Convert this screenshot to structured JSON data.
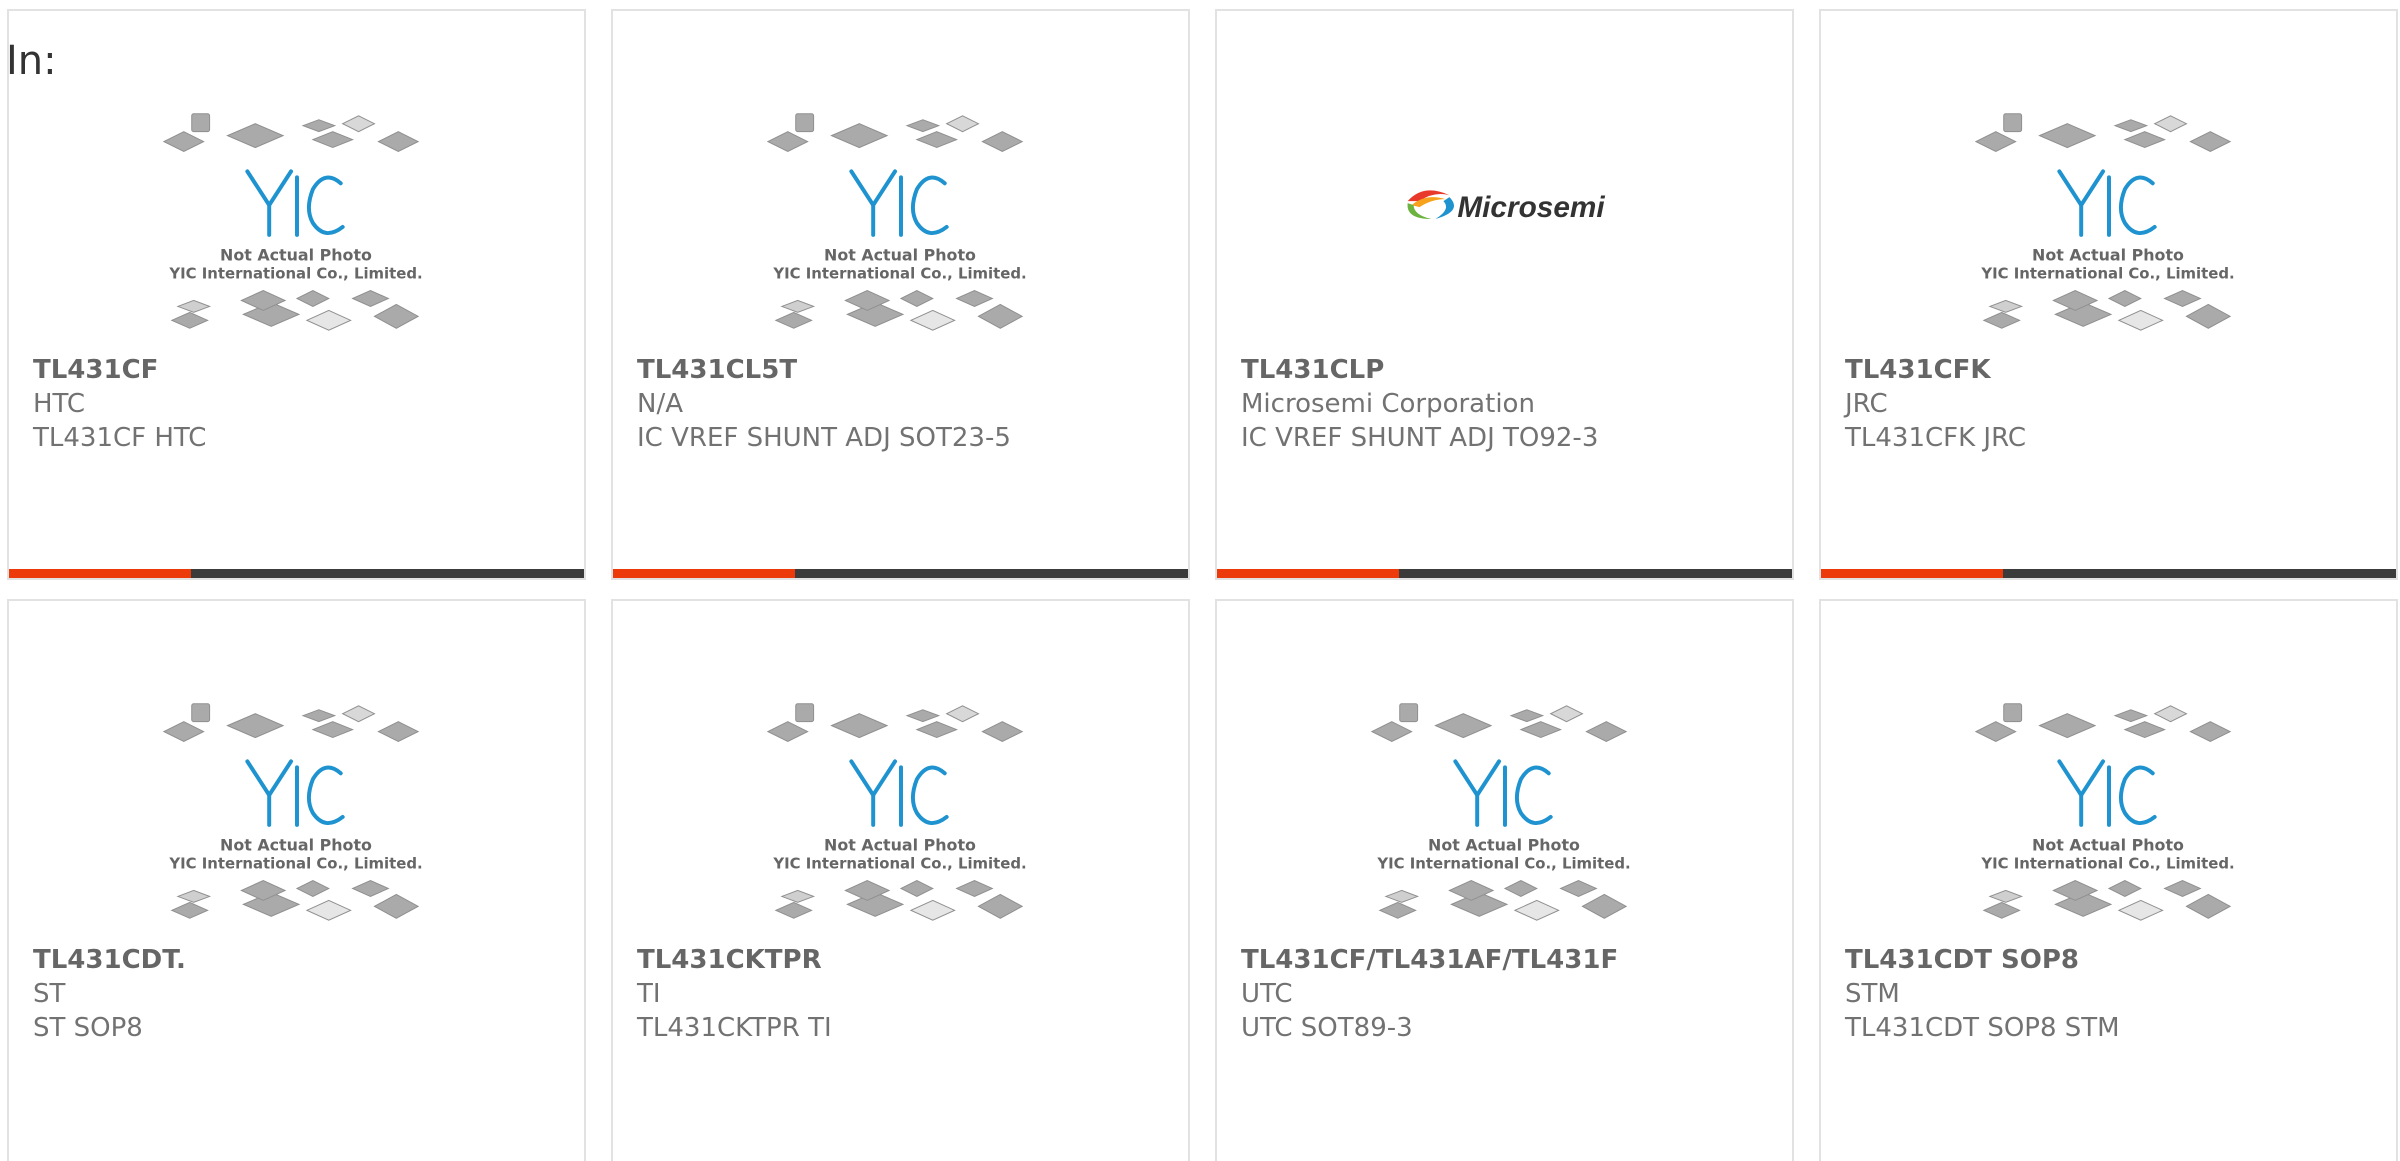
{
  "filter": {
    "label": "In:"
  },
  "placeholder_image": {
    "line1": "Not Actual Photo",
    "line2": "YIC International Co., Limited.",
    "logo_text": "YIC"
  },
  "microsemi_logo_text": "Microsemi",
  "colors": {
    "accent": "#ec3a0b",
    "bar": "#3b3b3b",
    "yic_blue": "#1f93cf",
    "text": "#666666"
  },
  "products": [
    {
      "part": "TL431CF",
      "brand": "HTC",
      "desc": "TL431CF HTC",
      "image": "yic-placeholder"
    },
    {
      "part": "TL431CL5T",
      "brand": "N/A",
      "desc": "IC VREF SHUNT ADJ SOT23-5",
      "image": "yic-placeholder"
    },
    {
      "part": "TL431CLP",
      "brand": "Microsemi Corporation",
      "desc": "IC VREF SHUNT ADJ TO92-3",
      "image": "microsemi-logo"
    },
    {
      "part": "TL431CFK",
      "brand": "JRC",
      "desc": "TL431CFK JRC",
      "image": "yic-placeholder"
    },
    {
      "part": "TL431CDT.",
      "brand": "ST",
      "desc": "ST SOP8",
      "image": "yic-placeholder"
    },
    {
      "part": "TL431CKTPR",
      "brand": "TI",
      "desc": "TL431CKTPR TI",
      "image": "yic-placeholder"
    },
    {
      "part": "TL431CF/TL431AF/TL431F",
      "brand": "UTC",
      "desc": "UTC SOT89-3",
      "image": "yic-placeholder"
    },
    {
      "part": "TL431CDT SOP8",
      "brand": "STM",
      "desc": "TL431CDT SOP8 STM",
      "image": "yic-placeholder"
    }
  ]
}
